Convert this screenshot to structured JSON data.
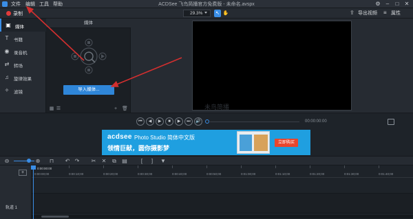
{
  "window": {
    "title": "ACDSee 飞鸟简播官方免费版 - 未命名.avspx",
    "menu": [
      "文件",
      "编辑",
      "工具",
      "帮助"
    ]
  },
  "toolbar": {
    "record_label": "录制",
    "zoom_value": "29.3%",
    "export_label": "导出视频",
    "properties_label": "属性"
  },
  "sidebar": {
    "items": [
      {
        "icon": "media-icon",
        "label": "媒体"
      },
      {
        "icon": "text-icon",
        "label": "书籍"
      },
      {
        "icon": "recorder-icon",
        "label": "录音机"
      },
      {
        "icon": "transition-icon",
        "label": "转场"
      },
      {
        "icon": "effects-icon",
        "label": "旋律效果"
      },
      {
        "icon": "filter-icon",
        "label": "滤镜"
      }
    ]
  },
  "media_panel": {
    "header": "媒体",
    "import_button": "导入媒体..."
  },
  "preview": {
    "watermark": "未鸟简播"
  },
  "playback": {
    "time": "00:00:00:00"
  },
  "banner": {
    "brand": "acdsee",
    "product": "Photo Studio 简体中文版",
    "slogan": "领情巨献，圆你摄影梦",
    "buy_button": "立即购买"
  },
  "timeline": {
    "playhead_time": "0:00:00:00",
    "ruler_ticks": [
      "0:00:00;00",
      "0:00:10;00",
      "0:00:20;00",
      "0:00:30;00",
      "0:00:40;00",
      "0:00:50;00",
      "0:01:00;00",
      "0:01:10;00",
      "0:01:20;00",
      "0:01:30;00",
      "0:01:40;00"
    ],
    "track_name": "轨道 1"
  },
  "colors": {
    "accent": "#3a8ee6",
    "record": "#e23b3b",
    "banner_bg": "#1f9fe0",
    "buy_button": "#e8452c",
    "annotation_arrow": "#d32f2f"
  }
}
